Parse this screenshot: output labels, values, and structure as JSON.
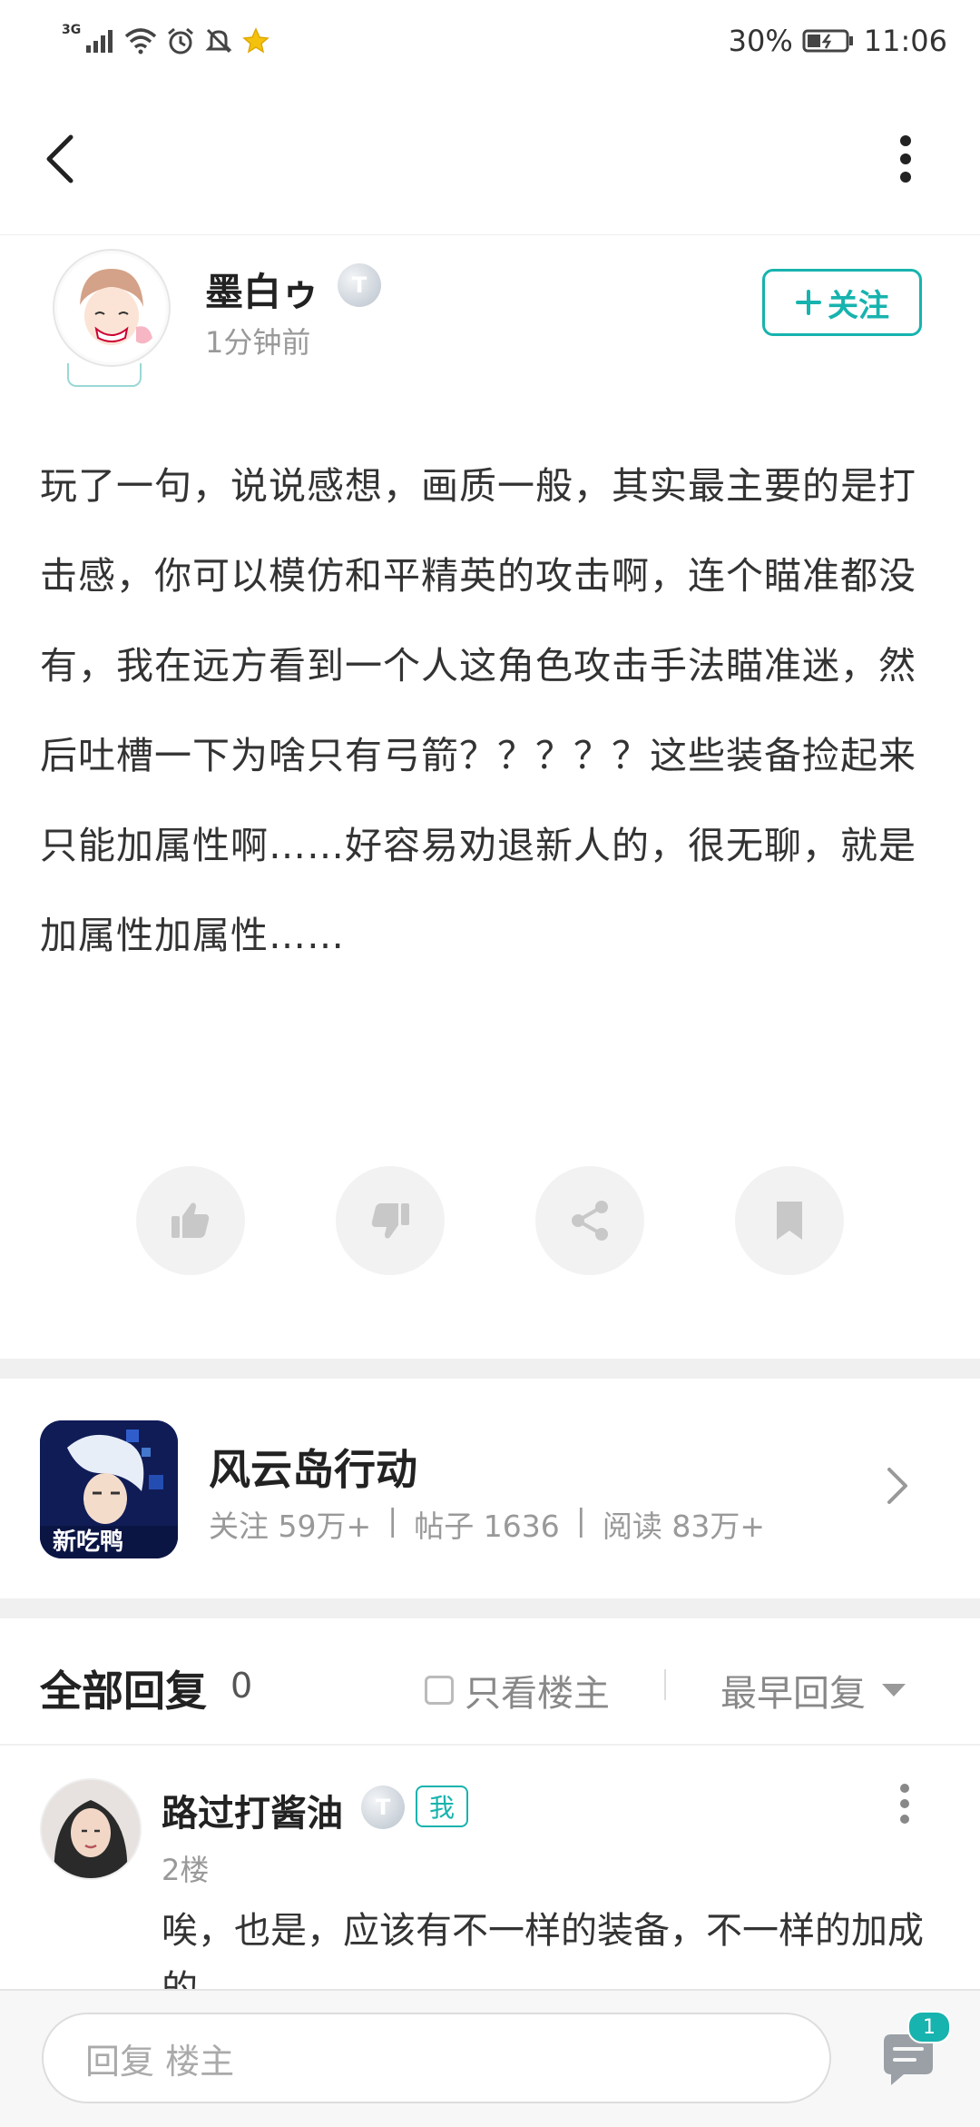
{
  "status_bar": {
    "network_label": "3G",
    "battery_percent": "30%",
    "time": "11:06",
    "icons": [
      "signal-icon",
      "wifi-icon",
      "alarm-icon",
      "mute-icon",
      "star-icon",
      "battery-icon"
    ]
  },
  "nav": {
    "back_icon": "chevron-left-icon",
    "more_icon": "more-vertical-icon"
  },
  "post": {
    "author_name": "墨白ゥ",
    "author_level": "T",
    "time": "1分钟前",
    "follow_label": "关注",
    "body": "玩了一句，说说感想，画质一般，其实最主要的是打击感，你可以模仿和平精英的攻击啊，连个瞄准都没有，我在远方看到一个人这角色攻击手法瞄准迷，然后吐槽一下为啥只有弓箭？？？？？这些装备捡起来只能加属性啊……好容易劝退新人的，很无聊，就是加属性加属性……",
    "actions": [
      "thumbs-up-icon",
      "thumbs-down-icon",
      "share-icon",
      "bookmark-icon"
    ]
  },
  "game": {
    "title": "风云岛行动",
    "icon_text": "新吃鸭",
    "follow_stat": "关注 59万+",
    "posts_stat": "帖子 1636",
    "reads_stat": "阅读 83万+",
    "divider": "|"
  },
  "replies": {
    "title": "全部回复",
    "count": "0",
    "op_only_label": "只看楼主",
    "sort_label": "最早回复",
    "items": [
      {
        "name": "路过打酱油",
        "level": "T",
        "tag": "我",
        "floor": "2楼",
        "text": "唉，也是，应该有不一样的装备，不一样的加成的。"
      }
    ]
  },
  "bottom_bar": {
    "placeholder": "回复  楼主",
    "badge_count": "1"
  },
  "colors": {
    "accent": "#17b3ae",
    "muted": "#999999",
    "separator": "#f0f0f0"
  }
}
